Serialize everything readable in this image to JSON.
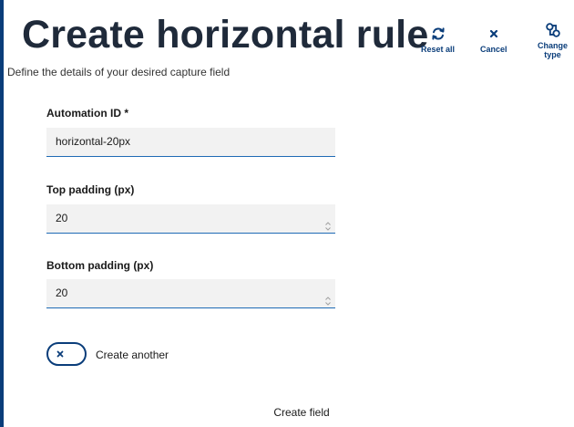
{
  "header": {
    "title": "Create horizontal rule",
    "subtitle": "Define the details of your desired capture field"
  },
  "toolbar": {
    "reset_label": "Reset all",
    "cancel_label": "Cancel",
    "change_label_line1": "Change",
    "change_label_line2": "type"
  },
  "form": {
    "automation_id": {
      "label": "Automation ID *",
      "value": "horizontal-20px"
    },
    "top_padding": {
      "label": "Top padding (px)",
      "value": "20"
    },
    "bottom_padding": {
      "label": "Bottom padding (px)",
      "value": "20"
    },
    "create_another": {
      "label": "Create another",
      "state": "off"
    },
    "submit_label": "Create field"
  },
  "colors": {
    "accent": "#0a3d7a",
    "input_underline": "#1f6bb5",
    "input_background": "#f2f2f2"
  },
  "icons": {
    "reset": "refresh-icon",
    "cancel": "close-icon",
    "change_type": "swap-icon",
    "toggle": "close-icon",
    "stepper": "chevron-up-down-icon"
  }
}
